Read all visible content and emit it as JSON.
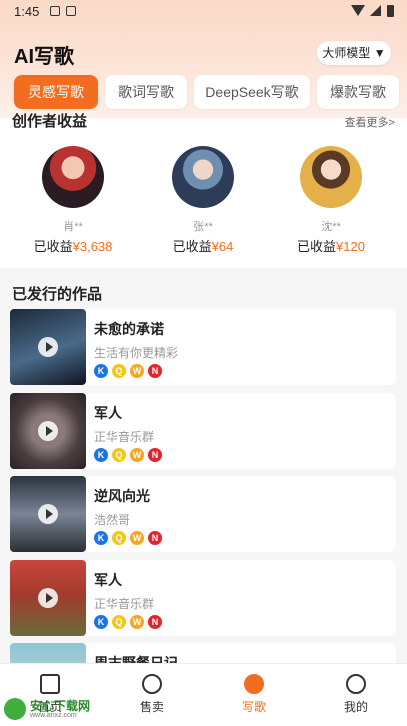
{
  "status": {
    "time": "1:45"
  },
  "app": {
    "title": "AI写歌",
    "model_selector": "大师模型 ▼"
  },
  "tabs": [
    {
      "label": "灵感写歌",
      "active": true
    },
    {
      "label": "歌词写歌",
      "active": false
    },
    {
      "label": "DeepSeek写歌",
      "active": false
    },
    {
      "label": "爆款写歌",
      "active": false
    }
  ],
  "earnings": {
    "title": "创作者收益",
    "more": "查看更多>",
    "creators": [
      {
        "name": "肖**",
        "label": "已收益",
        "amount": "¥3,638"
      },
      {
        "name": "张**",
        "label": "已收益",
        "amount": "¥64"
      },
      {
        "name": "沈**",
        "label": "已收益",
        "amount": "¥120"
      }
    ]
  },
  "works": {
    "title": "已发行的作品",
    "items": [
      {
        "title": "未愈的承诺",
        "subtitle": "生活有你更精彩"
      },
      {
        "title": "军人",
        "subtitle": "正华音乐群"
      },
      {
        "title": "逆风向光",
        "subtitle": "浩然哥"
      },
      {
        "title": "军人",
        "subtitle": "正华音乐群"
      },
      {
        "title": "周末野餐日记",
        "subtitle": ""
      }
    ],
    "platform_icons": [
      "kugou-icon",
      "qq-music-icon",
      "kuwo-icon",
      "netease-icon"
    ]
  },
  "nav": [
    {
      "label": "首页",
      "icon": "home-icon",
      "active": false
    },
    {
      "label": "售卖",
      "icon": "disc-icon",
      "active": false
    },
    {
      "label": "写歌",
      "icon": "write-song-icon",
      "active": true
    },
    {
      "label": "我的",
      "icon": "profile-icon",
      "active": false
    }
  ],
  "watermark": {
    "name": "安心下载网",
    "url": "www.anxz.com"
  },
  "colors": {
    "accent": "#f26d1f",
    "background": "#f6f6f7"
  }
}
